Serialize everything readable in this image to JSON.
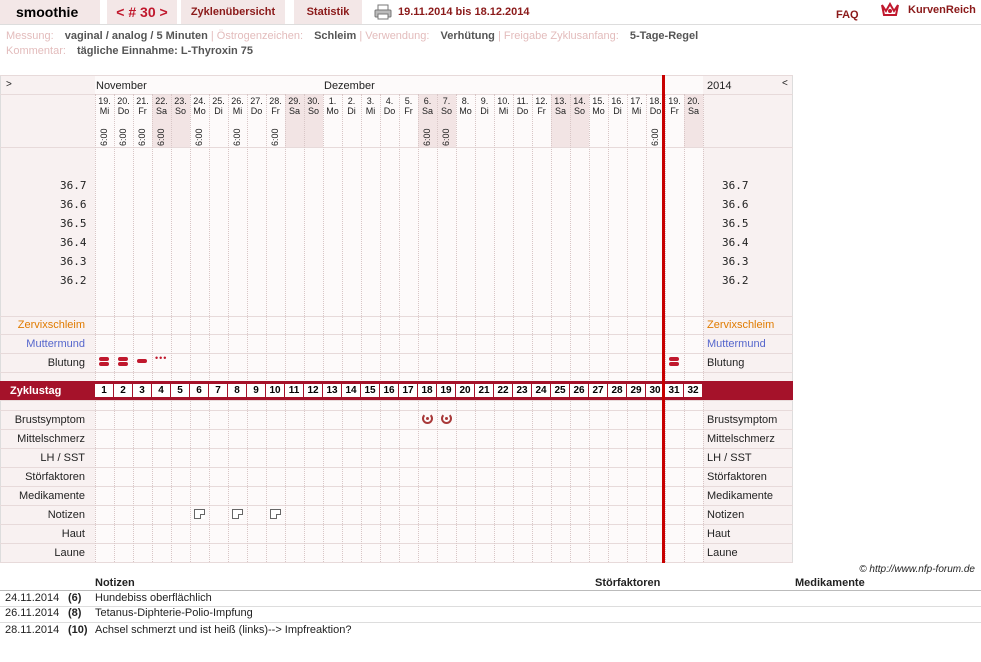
{
  "header": {
    "username": "smoothie",
    "cycle_nav": "< # 30 >",
    "tab_overview": "Zyklenübersicht",
    "tab_stats": "Statistik",
    "date_range": "19.11.2014 bis 18.12.2014",
    "faq": "FAQ",
    "logo_text": "KurvenReich"
  },
  "meta": {
    "messung_label": "Messung:",
    "messung_value": "vaginal / analog / 5 Minuten",
    "oestrogen_label": "Östrogenzeichen:",
    "oestrogen_value": "Schleim",
    "verwendung_label": "Verwendung:",
    "verwendung_value": "Verhütung",
    "freigabe_label": "Freigabe Zyklusanfang:",
    "freigabe_value": "5-Tage-Regel",
    "kommentar_label": "Kommentar:",
    "kommentar_value": "tägliche Einnahme: L-Thyroxin 75"
  },
  "chart": {
    "left_arrow": ">",
    "right_arrow": "<",
    "month1": "November",
    "month2": "Dezember",
    "year": "2014",
    "temps": [
      "36.7",
      "36.6",
      "36.5",
      "36.4",
      "36.3",
      "36.2"
    ],
    "row_labels": {
      "zervix": "Zervixschleim",
      "muttermund": "Muttermund",
      "blutung": "Blutung",
      "zyklustag": "Zyklustag",
      "brust": "Brustsymptom",
      "mittel": "Mittelschmerz",
      "lh": "LH / SST",
      "stoer": "Störfaktoren",
      "medi": "Medikamente",
      "notizen": "Notizen",
      "haut": "Haut",
      "laune": "Laune"
    },
    "colors": {
      "zervix": "#e07b00",
      "muttermund": "#5566cc",
      "cycle_bar": "#a5122a",
      "today_line": "#c80000"
    },
    "days": [
      {
        "d": "19.",
        "w": "Mi",
        "t": "6:00",
        "we": false
      },
      {
        "d": "20.",
        "w": "Do",
        "t": "6:00",
        "we": false
      },
      {
        "d": "21.",
        "w": "Fr",
        "t": "6:00",
        "we": false
      },
      {
        "d": "22.",
        "w": "Sa",
        "t": "6:00",
        "we": true
      },
      {
        "d": "23.",
        "w": "So",
        "t": "",
        "we": true
      },
      {
        "d": "24.",
        "w": "Mo",
        "t": "6:00",
        "we": false
      },
      {
        "d": "25.",
        "w": "Di",
        "t": "",
        "we": false
      },
      {
        "d": "26.",
        "w": "Mi",
        "t": "6:00",
        "we": false
      },
      {
        "d": "27.",
        "w": "Do",
        "t": "",
        "we": false
      },
      {
        "d": "28.",
        "w": "Fr",
        "t": "6:00",
        "we": false
      },
      {
        "d": "29.",
        "w": "Sa",
        "t": "",
        "we": true
      },
      {
        "d": "30.",
        "w": "So",
        "t": "",
        "we": true
      },
      {
        "d": "1.",
        "w": "Mo",
        "t": "",
        "we": false
      },
      {
        "d": "2.",
        "w": "Di",
        "t": "",
        "we": false
      },
      {
        "d": "3.",
        "w": "Mi",
        "t": "",
        "we": false
      },
      {
        "d": "4.",
        "w": "Do",
        "t": "",
        "we": false
      },
      {
        "d": "5.",
        "w": "Fr",
        "t": "",
        "we": false
      },
      {
        "d": "6.",
        "w": "Sa",
        "t": "6:00",
        "we": true
      },
      {
        "d": "7.",
        "w": "So",
        "t": "6:00",
        "we": true
      },
      {
        "d": "8.",
        "w": "Mo",
        "t": "",
        "we": false
      },
      {
        "d": "9.",
        "w": "Di",
        "t": "",
        "we": false
      },
      {
        "d": "10.",
        "w": "Mi",
        "t": "",
        "we": false
      },
      {
        "d": "11.",
        "w": "Do",
        "t": "",
        "we": false
      },
      {
        "d": "12.",
        "w": "Fr",
        "t": "",
        "we": false
      },
      {
        "d": "13.",
        "w": "Sa",
        "t": "",
        "we": true
      },
      {
        "d": "14.",
        "w": "So",
        "t": "",
        "we": true
      },
      {
        "d": "15.",
        "w": "Mo",
        "t": "",
        "we": false
      },
      {
        "d": "16.",
        "w": "Di",
        "t": "",
        "we": false
      },
      {
        "d": "17.",
        "w": "Mi",
        "t": "",
        "we": false
      },
      {
        "d": "18.",
        "w": "Do",
        "t": "6:00",
        "we": false
      },
      {
        "d": "19.",
        "w": "Fr",
        "t": "",
        "we": false
      },
      {
        "d": "20.",
        "w": "Sa",
        "t": "",
        "we": true
      }
    ],
    "cycle_days": [
      "1",
      "2",
      "3",
      "4",
      "5",
      "6",
      "7",
      "8",
      "9",
      "10",
      "11",
      "12",
      "13",
      "14",
      "15",
      "16",
      "17",
      "18",
      "19",
      "20",
      "21",
      "22",
      "23",
      "24",
      "25",
      "26",
      "27",
      "28",
      "29",
      "30",
      "31",
      "32"
    ],
    "bleeding": [
      2,
      2,
      1,
      "spot",
      0,
      0,
      0,
      0,
      0,
      0,
      0,
      0,
      0,
      0,
      0,
      0,
      0,
      0,
      0,
      0,
      0,
      0,
      0,
      0,
      0,
      0,
      0,
      0,
      0,
      0,
      2,
      0
    ],
    "breast_days": [
      18,
      19
    ],
    "note_days": [
      6,
      8,
      10
    ]
  },
  "copyright": "© http://www.nfp-forum.de",
  "notes_table": {
    "headers": {
      "notizen": "Notizen",
      "stoer": "Störfaktoren",
      "medi": "Medikamente"
    },
    "rows": [
      {
        "date": "24.11.2014",
        "cycle": "(6)",
        "text": "Hundebiss oberflächlich"
      },
      {
        "date": "26.11.2014",
        "cycle": "(8)",
        "text": "Tetanus-Diphterie-Polio-Impfung"
      },
      {
        "date": "28.11.2014",
        "cycle": "(10)",
        "text": "Achsel schmerzt und ist heiß (links)--> Impfreaktion?"
      }
    ]
  }
}
